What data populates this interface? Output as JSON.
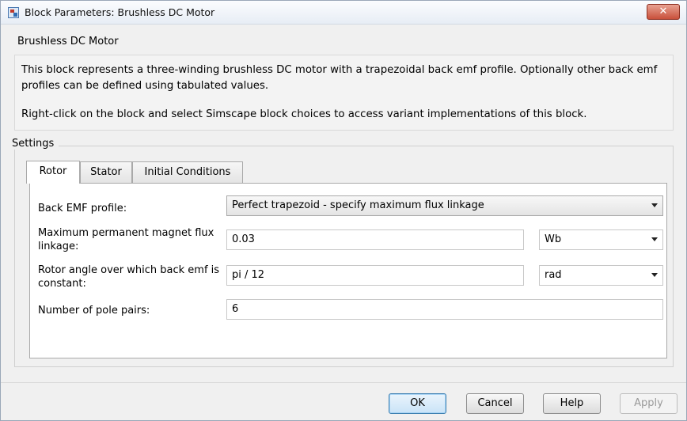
{
  "window": {
    "title": "Block Parameters: Brushless DC Motor",
    "close_label": "✕"
  },
  "block": {
    "name": "Brushless DC Motor",
    "description_1": "This block represents a three-winding brushless DC motor with a trapezoidal back emf profile. Optionally other back emf profiles can be defined using tabulated values.",
    "description_2": "Right-click on the block and select Simscape block choices to access variant implementations of this block."
  },
  "settings": {
    "label": "Settings",
    "tabs": [
      {
        "label": "Rotor",
        "active": true
      },
      {
        "label": "Stator",
        "active": false
      },
      {
        "label": "Initial Conditions",
        "active": false
      }
    ],
    "fields": {
      "back_emf_profile": {
        "label": "Back EMF profile:",
        "value": "Perfect trapezoid - specify maximum flux linkage"
      },
      "max_flux_linkage": {
        "label": "Maximum permanent magnet flux linkage:",
        "value": "0.03",
        "unit": "Wb"
      },
      "rotor_angle": {
        "label": "Rotor angle over which back emf is constant:",
        "value": "pi / 12",
        "unit": "rad"
      },
      "pole_pairs": {
        "label": "Number of pole pairs:",
        "value": "6"
      }
    }
  },
  "buttons": {
    "ok": "OK",
    "cancel": "Cancel",
    "help": "Help",
    "apply": "Apply"
  },
  "icons": {
    "window_icon": "simulink-block-icon",
    "close": "close-icon",
    "dropdown": "chevron-down-icon"
  },
  "colors": {
    "close_button": "#c9503b",
    "ok_border": "#3c7fb1"
  }
}
